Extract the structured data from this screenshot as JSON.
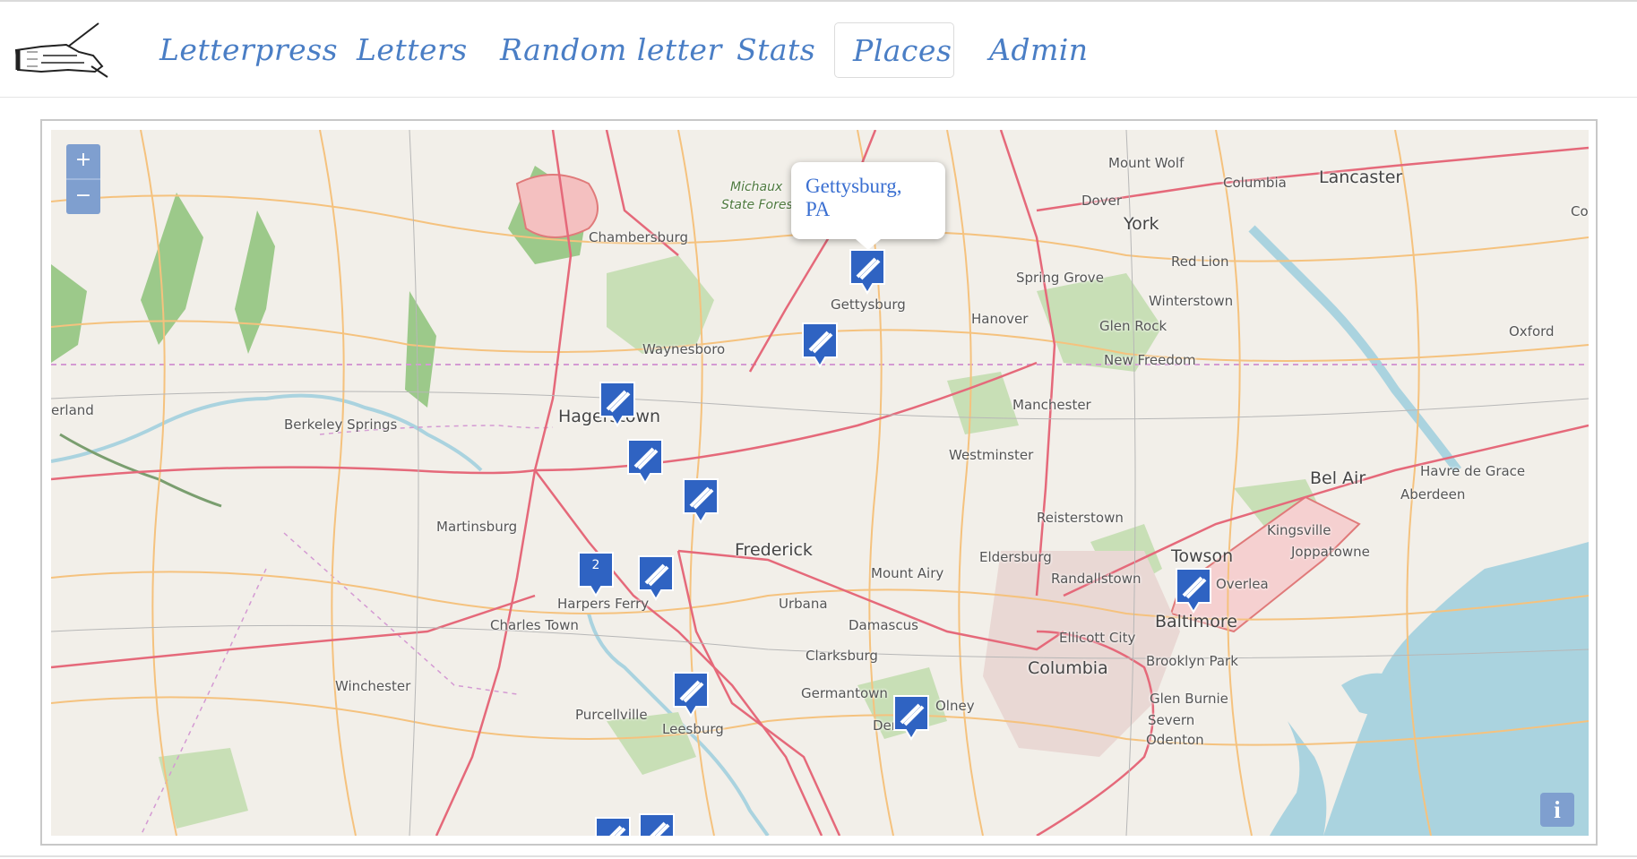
{
  "nav": {
    "logo_alt": "hand-writing-with-quill-logo",
    "items": [
      {
        "label": "Letterpress",
        "active": false
      },
      {
        "label": "Letters",
        "active": false
      },
      {
        "label": "Random letter",
        "active": false
      },
      {
        "label": "Stats",
        "active": false
      },
      {
        "label": "Places",
        "active": true
      },
      {
        "label": "Admin",
        "active": false
      }
    ]
  },
  "map": {
    "zoom_in": "+",
    "zoom_out": "−",
    "popup": {
      "title": "Gettysburg, PA"
    },
    "info_label": "i",
    "cluster_count": "2",
    "place_labels": {
      "mount_wolf": "Mount Wolf",
      "lancaster": "Lancaster",
      "columbia_pa": "Columbia",
      "dover": "Dover",
      "york": "York",
      "michaux": "Michaux",
      "state_forest": "State Forest",
      "chambersburg": "Chambersburg",
      "red_lion": "Red Lion",
      "spring_grove": "Spring Grove",
      "winterstown": "Winterstown",
      "gettysburg": "Gettysburg",
      "hanover": "Hanover",
      "glen_rock": "Glen Rock",
      "oxford": "Oxford",
      "waynesboro": "Waynesboro",
      "new_freedom": "New Freedom",
      "cumberland_partial": "erland",
      "hagerstown": "Hagerstown",
      "berkeley_springs": "Berkeley Springs",
      "manchester": "Manchester",
      "westminster": "Westminster",
      "bel_air": "Bel Air",
      "havre_de_grace": "Havre de Grace",
      "aberdeen": "Aberdeen",
      "martinsburg": "Martinsburg",
      "reisterstown": "Reisterstown",
      "kingsville": "Kingsville",
      "frederick": "Frederick",
      "joppatowne": "Joppatowne",
      "eldersburg": "Eldersburg",
      "towson": "Towson",
      "mount_airy": "Mount Airy",
      "randallstown": "Randallstown",
      "overlea": "Overlea",
      "harpers_ferry": "Harpers Ferry",
      "urbana": "Urbana",
      "baltimore": "Baltimore",
      "charles_town": "Charles Town",
      "damascus": "Damascus",
      "ellicott_city": "Ellicott City",
      "clarksburg": "Clarksburg",
      "brooklyn_park": "Brooklyn Park",
      "columbia_md": "Columbia",
      "winchester": "Winchester",
      "germantown": "Germantown",
      "glen_burnie": "Glen Burnie",
      "olney": "Olney",
      "purcellville": "Purcellville",
      "leesburg": "Leesburg",
      "severn": "Severn",
      "derwood_partial": "Der     d",
      "odenton_partial": "Odenton",
      "cut_right": "Co"
    }
  },
  "colors": {
    "nav_link": "#4a7ec5",
    "marker": "#2f63c2",
    "map_bg": "#f2efe9",
    "water": "#aad3df",
    "forest": "#9cc98a",
    "road_major": "#e5697a",
    "road_minor": "#f5c27e"
  }
}
